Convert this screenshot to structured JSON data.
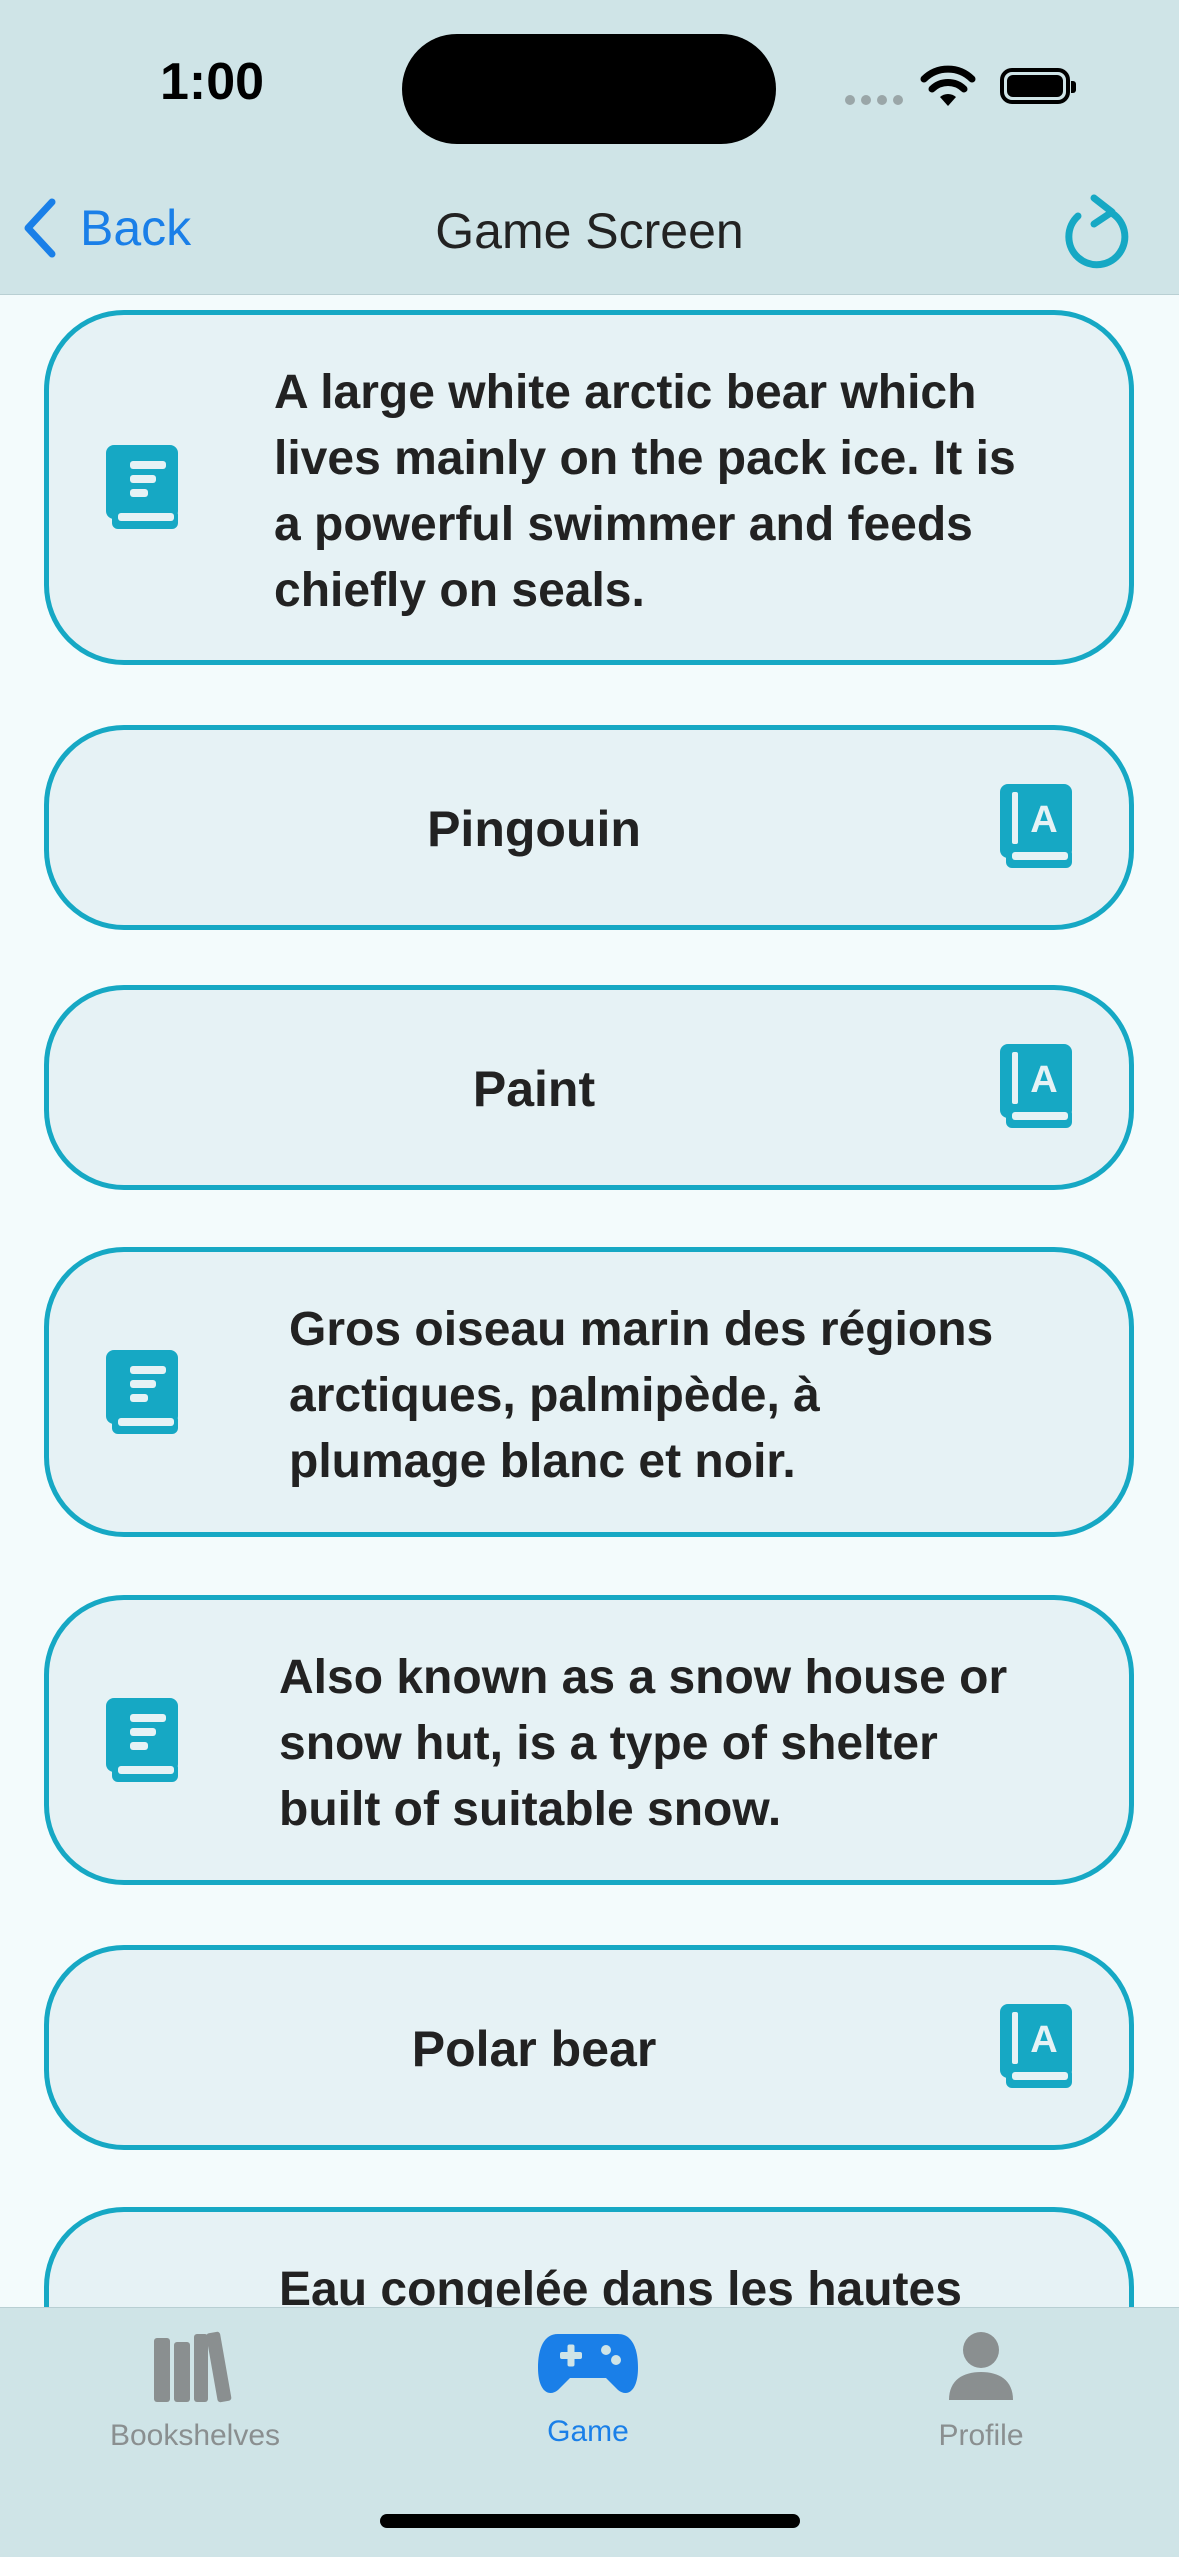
{
  "status": {
    "time": "1:00"
  },
  "nav": {
    "back_label": "Back",
    "title": "Game Screen"
  },
  "cards": [
    {
      "type": "definition",
      "text": "A large white arctic bear which\nlives mainly on the pack ice. It is\na powerful swimmer and feeds\nchiefly on seals."
    },
    {
      "type": "word",
      "text": "Pingouin"
    },
    {
      "type": "word",
      "text": "Paint"
    },
    {
      "type": "definition",
      "text": "Gros oiseau marin des régions\narctiques, palmipède, à\nplumage blanc et noir."
    },
    {
      "type": "definition",
      "text": "Also known as a snow house or\nsnow hut, is a type of shelter\nbuilt of suitable snow."
    },
    {
      "type": "word",
      "text": "Polar bear"
    },
    {
      "type": "definition",
      "text": "Eau congelée dans les hautes"
    }
  ],
  "tabs": [
    {
      "label": "Bookshelves",
      "icon": "bookshelves-icon",
      "active": false
    },
    {
      "label": "Game",
      "icon": "gamepad-icon",
      "active": true
    },
    {
      "label": "Profile",
      "icon": "person-icon",
      "active": false
    }
  ],
  "colors": {
    "accent": "#16a8c4",
    "link": "#1a7fe8",
    "bar": "#cfe4e7",
    "card": "#e6f2f5"
  }
}
